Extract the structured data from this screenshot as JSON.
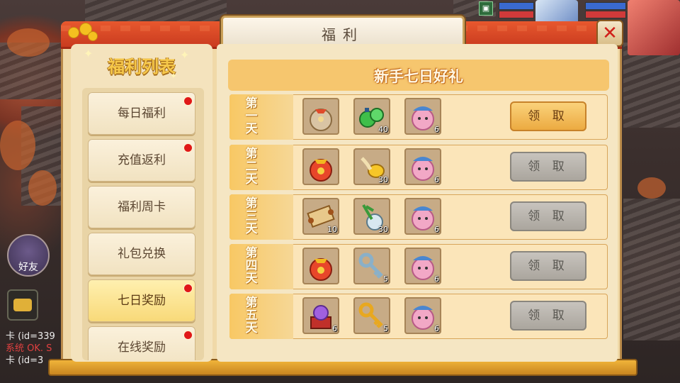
{
  "window": {
    "title": "福利",
    "close_label": "✕"
  },
  "sidebar": {
    "title": "福利列表",
    "items": [
      {
        "label": "每日福利",
        "badge": true,
        "active": false
      },
      {
        "label": "充值返利",
        "badge": true,
        "active": false
      },
      {
        "label": "福利周卡",
        "badge": false,
        "active": false
      },
      {
        "label": "礼包兑换",
        "badge": false,
        "active": false
      },
      {
        "label": "七日奖励",
        "badge": true,
        "active": true
      },
      {
        "label": "在线奖励",
        "badge": true,
        "active": false
      }
    ]
  },
  "main": {
    "title": "新手七日好礼",
    "days": [
      {
        "day": "第一天",
        "claim_label": "领 取",
        "claim_enabled": true,
        "items": [
          {
            "icon": "treasure-bag-icon",
            "qty": ""
          },
          {
            "icon": "green-potion-icon",
            "qty": "40"
          },
          {
            "icon": "pink-pet-icon",
            "qty": "6"
          }
        ]
      },
      {
        "day": "第二天",
        "claim_label": "领 取",
        "claim_enabled": false,
        "items": [
          {
            "icon": "red-gift-bag-icon",
            "qty": ""
          },
          {
            "icon": "gold-coins-icon",
            "qty": "30"
          },
          {
            "icon": "pink-pet-icon",
            "qty": "6"
          }
        ]
      },
      {
        "day": "第三天",
        "claim_label": "领 取",
        "claim_enabled": false,
        "items": [
          {
            "icon": "scroll-icon",
            "qty": "10"
          },
          {
            "icon": "herb-bottle-icon",
            "qty": "30"
          },
          {
            "icon": "pink-pet-icon",
            "qty": "6"
          }
        ]
      },
      {
        "day": "第四天",
        "claim_label": "领 取",
        "claim_enabled": false,
        "items": [
          {
            "icon": "red-gift-bag-icon",
            "qty": ""
          },
          {
            "icon": "silver-key-icon",
            "qty": "5"
          },
          {
            "icon": "pink-pet-icon",
            "qty": "6"
          }
        ]
      },
      {
        "day": "第五天",
        "claim_label": "领 取",
        "claim_enabled": false,
        "items": [
          {
            "icon": "crystal-ball-chest-icon",
            "qty": "6"
          },
          {
            "icon": "gold-key-icon",
            "qty": "5"
          },
          {
            "icon": "pink-pet-icon",
            "qty": "6"
          }
        ]
      }
    ]
  },
  "hud": {
    "friend_label": "好友",
    "chat_lines": [
      "卡 (id=339",
      "系统 OK. S",
      "卡 (id=3"
    ]
  },
  "colors": {
    "accent": "#f6c66e",
    "header_red": "#d9482a",
    "badge_red": "#e01818",
    "claim_active": "#eba83e",
    "claim_disabled": "#a9a49c"
  }
}
